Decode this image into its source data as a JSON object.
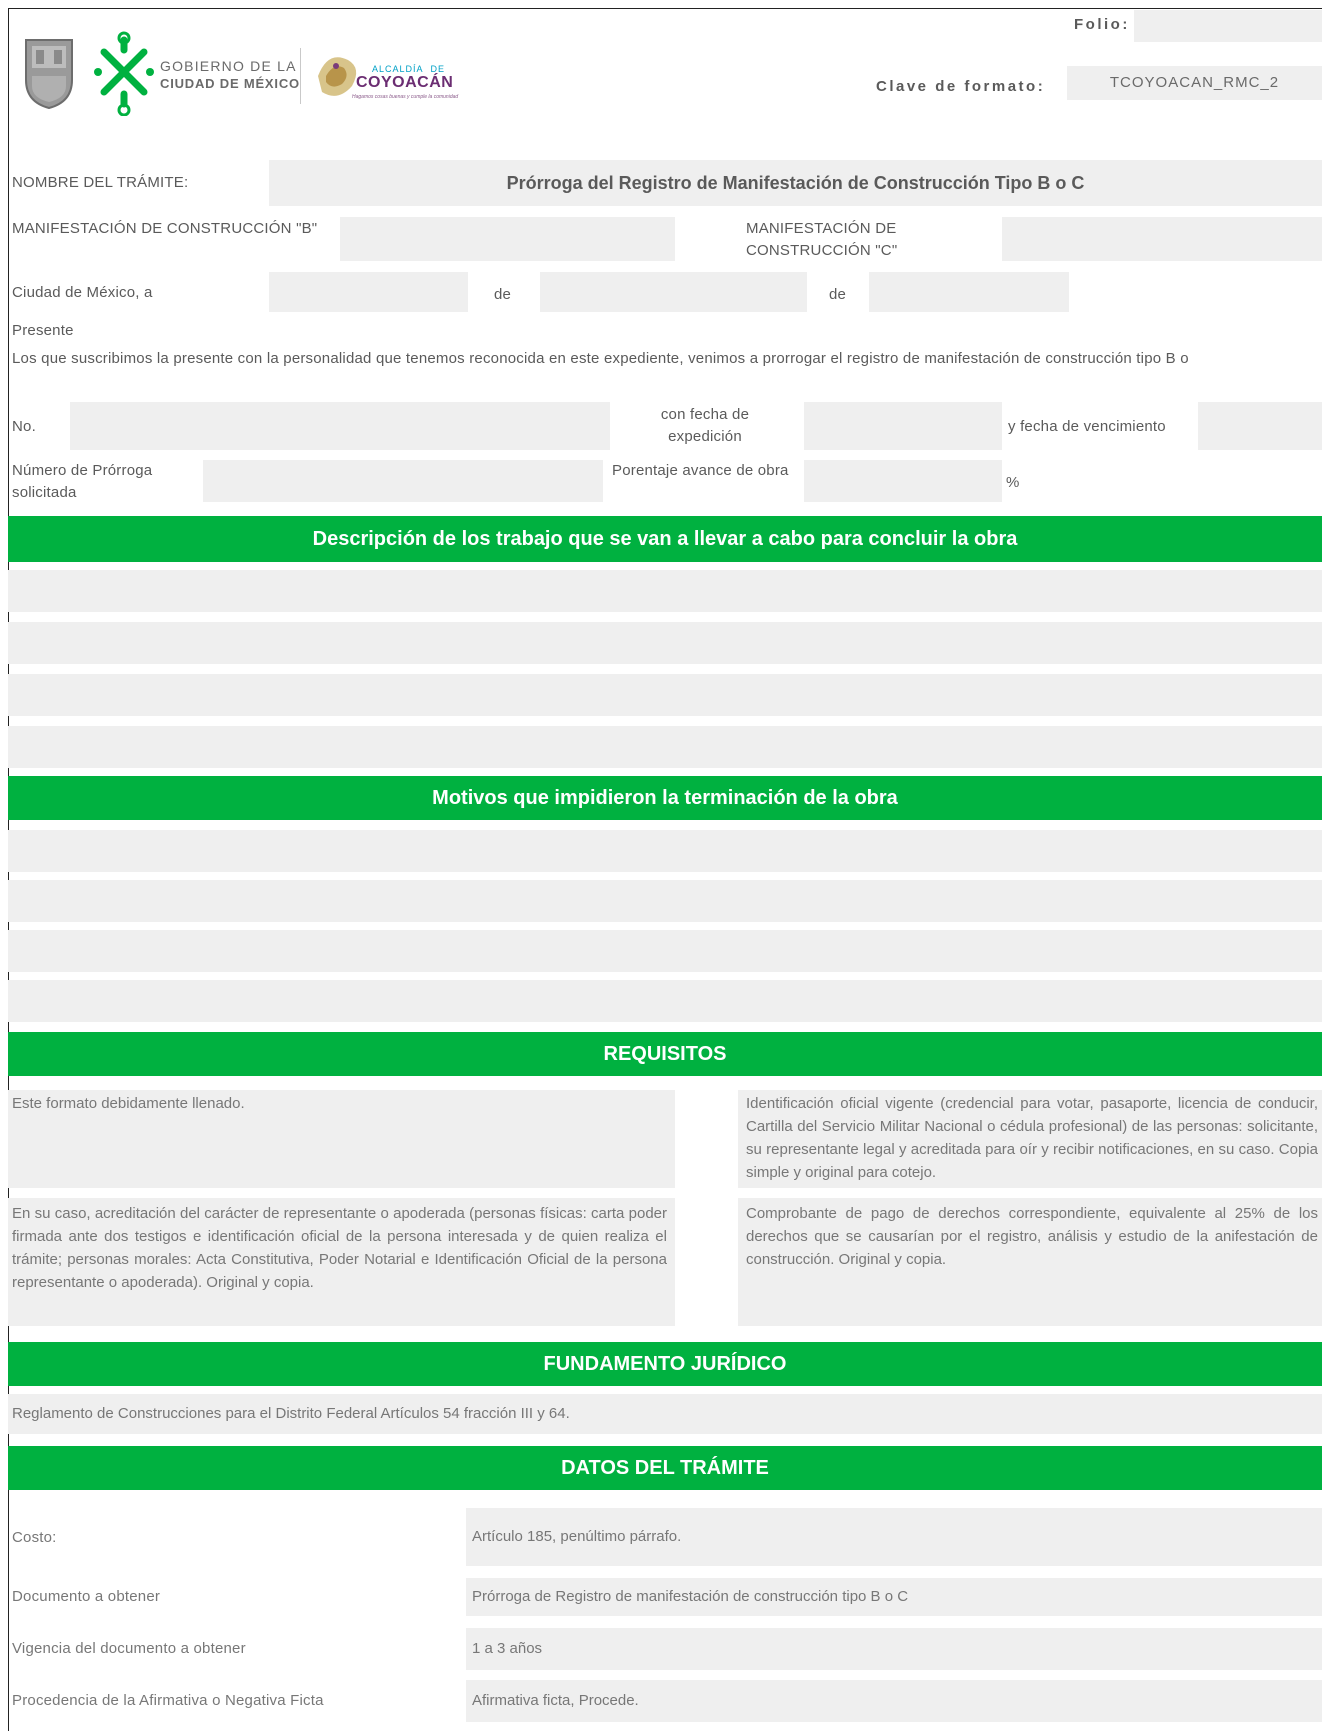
{
  "header": {
    "logo_gov_line1": "GOBIERNO DE LA",
    "logo_gov_line2": "CIUDAD DE MÉXICO",
    "logo_alcaldia_small": "ALCALDÍA",
    "logo_alcaldia_de": "DE",
    "logo_alcaldia_name": "COYOACÁN",
    "logo_alcaldia_tagline": "Hagamos cosas buenas y cumple la comunidad",
    "folio_label": "Folio:",
    "folio_value": "",
    "clave_label": "Clave de formato:",
    "clave_value": "TCOYOACAN_RMC_2"
  },
  "form": {
    "nombre_label": "NOMBRE DEL TRÁMITE:",
    "nombre_value": "Prórroga del Registro de Manifestación de Construcción Tipo B o C",
    "manif_b_label": "MANIFESTACIÓN DE CONSTRUCCIÓN \"B\"",
    "manif_c_label": "MANIFESTACIÓN DE CONSTRUCCIÓN \"C\"",
    "ciudad_label": "Ciudad de México, a",
    "de1": "de",
    "de2": "de",
    "presente": "Presente",
    "intro": "Los que suscribimos la presente con la personalidad que tenemos reconocida en este expediente, venimos a prorrogar el registro de manifestación de construcción tipo B o",
    "no_label": "No.",
    "fecha_exp_label": "con fecha de expedición",
    "fecha_venc_label": "y fecha de vencimiento",
    "num_prorroga_label": "Número de Prórroga solicitada",
    "porcentaje_label": "Porentaje avance de obra",
    "percent_sign": "%"
  },
  "sections": {
    "descripcion": "Descripción de los trabajo que se van a llevar a cabo para concluir la obra",
    "motivos": "Motivos que impidieron la terminación de la obra",
    "requisitos": "REQUISITOS",
    "fundamento": "FUNDAMENTO JURÍDICO",
    "datos": "DATOS DEL TRÁMITE"
  },
  "requisitos": {
    "r1": "Este formato debidamente llenado.",
    "r2": "Identificación oficial vigente (credencial para votar, pasaporte, licencia de conducir, Cartilla del Servicio Militar Nacional o cédula profesional) de las personas: solicitante, su representante legal y acreditada para oír y recibir notificaciones, en su caso. Copia simple y original para cotejo.",
    "r3": "En su caso, acreditación del carácter de representante o apoderada (personas físicas: carta poder firmada ante dos testigos e identificación oficial de la persona interesada y de quien realiza el trámite; personas morales: Acta Constitutiva, Poder Notarial e Identificación Oficial de la persona representante o apoderada). Original y copia.",
    "r4": "Comprobante de pago de derechos correspondiente, equivalente al 25% de los derechos que se causarían por el registro, análisis y estudio de la anifestación de construcción. Original y copia."
  },
  "fundamento_text": "Reglamento de Construcciones para el Distrito Federal Artículos 54 fracción III y 64.",
  "datos": [
    {
      "label": "Costo:",
      "value": "Artículo 185, penúltimo párrafo."
    },
    {
      "label": "Documento a obtener",
      "value": "Prórroga de Registro de manifestación de construcción tipo B o C"
    },
    {
      "label": "Vigencia del documento a obtener",
      "value": "1 a 3 años"
    },
    {
      "label": "Procedencia de la Afirmativa o Negativa Ficta",
      "value": "Afirmativa ficta, Procede."
    }
  ]
}
